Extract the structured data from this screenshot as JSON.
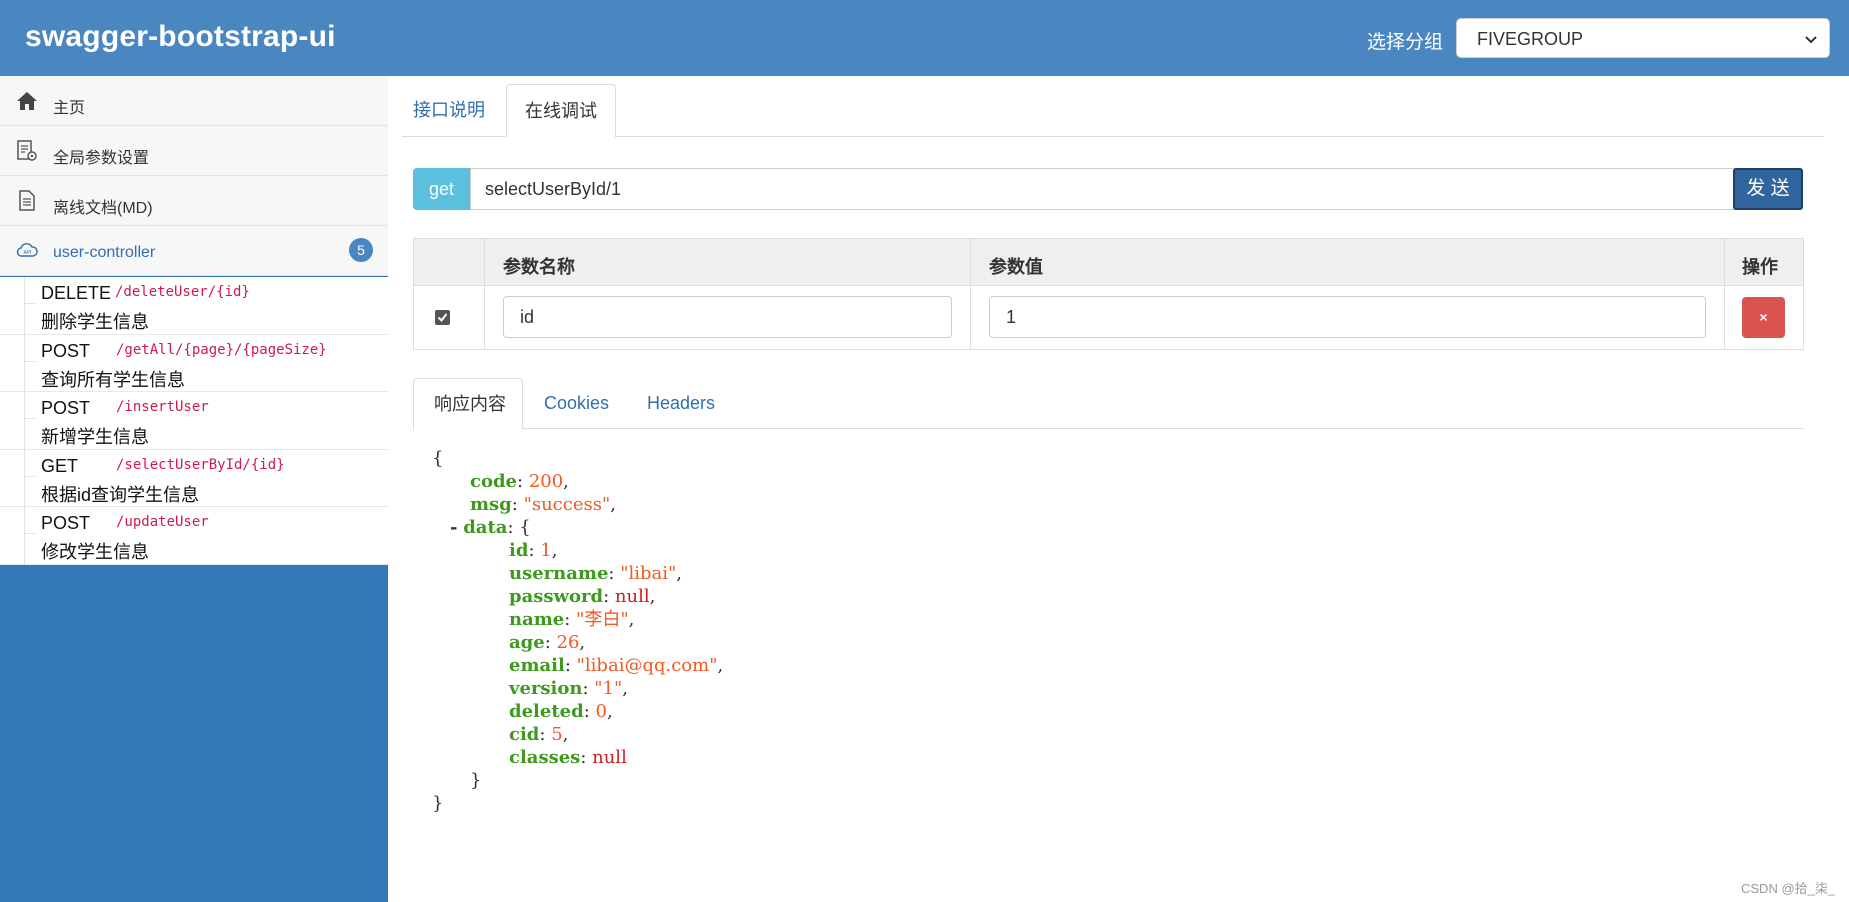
{
  "header": {
    "brand": "swagger-bootstrap-ui",
    "group_label": "选择分组",
    "group_value": "FIVEGROUP",
    "bg_color": "#4a87c0"
  },
  "sidebar": {
    "menu": [
      {
        "label": "主页",
        "icon": "home-icon"
      },
      {
        "label": "全局参数设置",
        "icon": "settings-doc-icon"
      },
      {
        "label": "离线文档(MD)",
        "icon": "document-icon"
      },
      {
        "label": "user-controller",
        "icon": "cloud-api-icon"
      }
    ],
    "controller_count": "5",
    "apis": [
      {
        "method": "DELETE",
        "path": "/deleteUser/{id}",
        "desc": "删除学生信息"
      },
      {
        "method": "POST",
        "path": "/getAll/{page}/{pageSize}",
        "desc": "查询所有学生信息"
      },
      {
        "method": "POST",
        "path": "/insertUser",
        "desc": "新增学生信息"
      },
      {
        "method": "GET",
        "path": "/selectUserById/{id}",
        "desc": "根据id查询学生信息"
      },
      {
        "method": "POST",
        "path": "/updateUser",
        "desc": "修改学生信息"
      }
    ],
    "bg_color": "#3478b6"
  },
  "main": {
    "tabs": [
      {
        "label": "接口说明",
        "active": false
      },
      {
        "label": "在线调试",
        "active": true
      }
    ],
    "request": {
      "method": "get",
      "url": "selectUserById/1",
      "send_label": "发 送"
    },
    "params": {
      "headers": [
        "参数名称",
        "参数值",
        "操作"
      ],
      "rows": [
        {
          "checked": true,
          "name": "id",
          "value": "1",
          "delete_label": "×"
        }
      ]
    },
    "response_tabs": [
      {
        "label": "响应内容",
        "active": true
      },
      {
        "label": "Cookies",
        "active": false
      },
      {
        "label": "Headers",
        "active": false
      }
    ],
    "response": {
      "open_brace": "{",
      "close_brace": "}",
      "code_key": "code",
      "code_val": "200",
      "msg_key": "msg",
      "msg_val": "\"success\"",
      "collapse_marker": "-",
      "data_key": "data",
      "fields": [
        {
          "key": "id",
          "val": "1",
          "type": "num"
        },
        {
          "key": "username",
          "val": "\"libai\"",
          "type": "str"
        },
        {
          "key": "password",
          "val": "null",
          "type": "nul"
        },
        {
          "key": "name",
          "val": "\"李白\"",
          "type": "str"
        },
        {
          "key": "age",
          "val": "26",
          "type": "num"
        },
        {
          "key": "email",
          "val": "\"libai@qq.com\"",
          "type": "str"
        },
        {
          "key": "version",
          "val": "\"1\"",
          "type": "str"
        },
        {
          "key": "deleted",
          "val": "0",
          "type": "num"
        },
        {
          "key": "cid",
          "val": "5",
          "type": "num"
        },
        {
          "key": "classes",
          "val": "null",
          "type": "nul"
        }
      ]
    }
  },
  "watermark": "CSDN @拾_柒_"
}
